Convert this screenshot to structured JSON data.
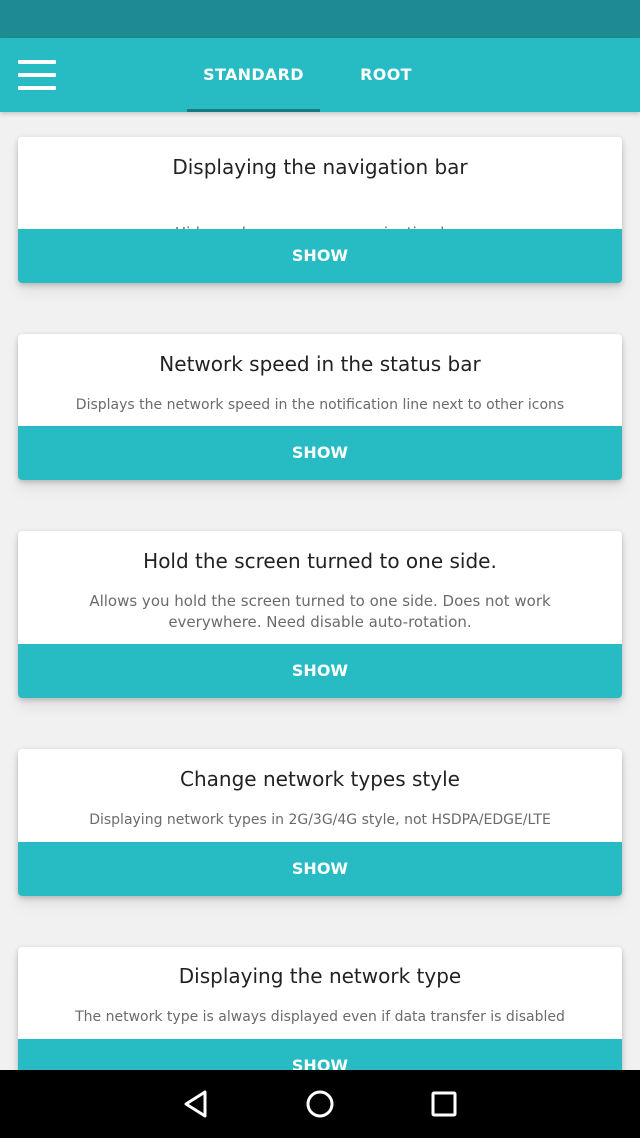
{
  "colors": {
    "status_bar": "#1e8a92",
    "accent": "#27bcc4",
    "background": "#f1f1f1",
    "card": "#ffffff",
    "nav_bar": "#000000"
  },
  "toolbar": {
    "menu_icon": "hamburger-menu-icon",
    "tabs": [
      {
        "label": "STANDARD",
        "selected": true
      },
      {
        "label": "ROOT",
        "selected": false
      }
    ]
  },
  "cards": [
    {
      "title": "Displaying the navigation bar",
      "description": "Hide or show on-screen navigation bar",
      "button_label": "SHOW"
    },
    {
      "title": "Network speed in the status bar",
      "description": "Displays the network speed in the notification line next to other icons",
      "button_label": "SHOW"
    },
    {
      "title": "Hold the screen turned to one side.",
      "description": "Allows you hold the screen turned to one side. Does not work everywhere. Need disable auto-rotation.",
      "button_label": "SHOW"
    },
    {
      "title": "Change network types style",
      "description": "Displaying network types in 2G/3G/4G style, not HSDPA/EDGE/LTE",
      "button_label": "SHOW"
    },
    {
      "title": "Displaying the network type",
      "description": "The network type is always displayed even if data transfer is disabled",
      "button_label": "SHOW"
    }
  ],
  "system_nav": {
    "icons": [
      "back-icon",
      "home-icon",
      "recents-icon"
    ]
  }
}
